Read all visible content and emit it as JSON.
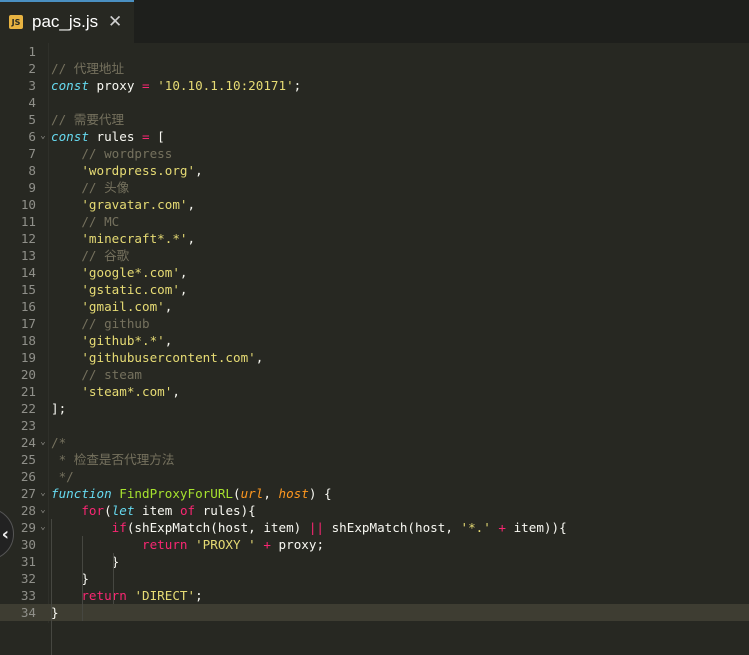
{
  "tab": {
    "title": "pac_js.js",
    "icon_label": "JS",
    "close_glyph": "✕"
  },
  "side_button": {
    "glyph": "‹"
  },
  "active_line": 34,
  "lines": [
    {
      "n": "1",
      "fold": "",
      "tokens": []
    },
    {
      "n": "2",
      "fold": "",
      "tokens": [
        {
          "t": "// 代理地址",
          "c": "c"
        }
      ]
    },
    {
      "n": "3",
      "fold": "",
      "tokens": [
        {
          "t": "const",
          "c": "k"
        },
        {
          "t": " proxy "
        },
        {
          "t": "=",
          "c": "r"
        },
        {
          "t": " "
        },
        {
          "t": "'10.10.1.10:20171'",
          "c": "s"
        },
        {
          "t": ";"
        }
      ]
    },
    {
      "n": "4",
      "fold": "",
      "tokens": []
    },
    {
      "n": "5",
      "fold": "",
      "tokens": [
        {
          "t": "// 需要代理",
          "c": "c"
        }
      ]
    },
    {
      "n": "6",
      "fold": "⌄",
      "tokens": [
        {
          "t": "const",
          "c": "k"
        },
        {
          "t": " rules "
        },
        {
          "t": "=",
          "c": "r"
        },
        {
          "t": " ["
        }
      ]
    },
    {
      "n": "7",
      "fold": "",
      "tokens": [
        {
          "t": "    "
        },
        {
          "t": "// wordpress",
          "c": "c"
        }
      ]
    },
    {
      "n": "8",
      "fold": "",
      "tokens": [
        {
          "t": "    "
        },
        {
          "t": "'wordpress.org'",
          "c": "s"
        },
        {
          "t": ","
        }
      ]
    },
    {
      "n": "9",
      "fold": "",
      "tokens": [
        {
          "t": "    "
        },
        {
          "t": "// 头像",
          "c": "c"
        }
      ]
    },
    {
      "n": "10",
      "fold": "",
      "tokens": [
        {
          "t": "    "
        },
        {
          "t": "'gravatar.com'",
          "c": "s"
        },
        {
          "t": ","
        }
      ]
    },
    {
      "n": "11",
      "fold": "",
      "tokens": [
        {
          "t": "    "
        },
        {
          "t": "// MC",
          "c": "c"
        }
      ]
    },
    {
      "n": "12",
      "fold": "",
      "tokens": [
        {
          "t": "    "
        },
        {
          "t": "'minecraft*.*'",
          "c": "s"
        },
        {
          "t": ","
        }
      ]
    },
    {
      "n": "13",
      "fold": "",
      "tokens": [
        {
          "t": "    "
        },
        {
          "t": "// 谷歌",
          "c": "c"
        }
      ]
    },
    {
      "n": "14",
      "fold": "",
      "tokens": [
        {
          "t": "    "
        },
        {
          "t": "'google*.com'",
          "c": "s"
        },
        {
          "t": ","
        }
      ]
    },
    {
      "n": "15",
      "fold": "",
      "tokens": [
        {
          "t": "    "
        },
        {
          "t": "'gstatic.com'",
          "c": "s"
        },
        {
          "t": ","
        }
      ]
    },
    {
      "n": "16",
      "fold": "",
      "tokens": [
        {
          "t": "    "
        },
        {
          "t": "'gmail.com'",
          "c": "s"
        },
        {
          "t": ","
        }
      ]
    },
    {
      "n": "17",
      "fold": "",
      "tokens": [
        {
          "t": "    "
        },
        {
          "t": "// github",
          "c": "c"
        }
      ]
    },
    {
      "n": "18",
      "fold": "",
      "tokens": [
        {
          "t": "    "
        },
        {
          "t": "'github*.*'",
          "c": "s"
        },
        {
          "t": ","
        }
      ]
    },
    {
      "n": "19",
      "fold": "",
      "tokens": [
        {
          "t": "    "
        },
        {
          "t": "'githubusercontent.com'",
          "c": "s"
        },
        {
          "t": ","
        }
      ]
    },
    {
      "n": "20",
      "fold": "",
      "tokens": [
        {
          "t": "    "
        },
        {
          "t": "// steam",
          "c": "c"
        }
      ]
    },
    {
      "n": "21",
      "fold": "",
      "tokens": [
        {
          "t": "    "
        },
        {
          "t": "'steam*.com'",
          "c": "s"
        },
        {
          "t": ","
        }
      ]
    },
    {
      "n": "22",
      "fold": "",
      "tokens": [
        {
          "t": "];"
        }
      ]
    },
    {
      "n": "23",
      "fold": "",
      "tokens": []
    },
    {
      "n": "24",
      "fold": "⌄",
      "tokens": [
        {
          "t": "/*",
          "c": "c"
        }
      ]
    },
    {
      "n": "25",
      "fold": "",
      "tokens": [
        {
          "t": " * 检查是否代理方法",
          "c": "c"
        }
      ]
    },
    {
      "n": "26",
      "fold": "",
      "tokens": [
        {
          "t": " */",
          "c": "c"
        }
      ]
    },
    {
      "n": "27",
      "fold": "⌄",
      "tokens": [
        {
          "t": "function",
          "c": "k"
        },
        {
          "t": " "
        },
        {
          "t": "FindProxyForURL",
          "c": "f"
        },
        {
          "t": "("
        },
        {
          "t": "url",
          "c": "p"
        },
        {
          "t": ", "
        },
        {
          "t": "host",
          "c": "p"
        },
        {
          "t": ") {"
        }
      ]
    },
    {
      "n": "28",
      "fold": "⌄",
      "tokens": [
        {
          "t": "    "
        },
        {
          "t": "for",
          "c": "r"
        },
        {
          "t": "("
        },
        {
          "t": "let",
          "c": "k"
        },
        {
          "t": " item "
        },
        {
          "t": "of",
          "c": "r"
        },
        {
          "t": " rules){"
        }
      ]
    },
    {
      "n": "29",
      "fold": "⌄",
      "tokens": [
        {
          "t": "        "
        },
        {
          "t": "if",
          "c": "r"
        },
        {
          "t": "(shExpMatch(host, item) "
        },
        {
          "t": "||",
          "c": "r"
        },
        {
          "t": " shExpMatch(host, "
        },
        {
          "t": "'*.'",
          "c": "s"
        },
        {
          "t": " "
        },
        {
          "t": "+",
          "c": "r"
        },
        {
          "t": " item)){"
        }
      ]
    },
    {
      "n": "30",
      "fold": "",
      "tokens": [
        {
          "t": "            "
        },
        {
          "t": "return",
          "c": "r"
        },
        {
          "t": " "
        },
        {
          "t": "'PROXY '",
          "c": "s"
        },
        {
          "t": " "
        },
        {
          "t": "+",
          "c": "r"
        },
        {
          "t": " proxy;"
        }
      ]
    },
    {
      "n": "31",
      "fold": "",
      "tokens": [
        {
          "t": "        }"
        }
      ]
    },
    {
      "n": "32",
      "fold": "",
      "tokens": [
        {
          "t": "    }"
        }
      ]
    },
    {
      "n": "33",
      "fold": "",
      "tokens": [
        {
          "t": "    "
        },
        {
          "t": "return",
          "c": "r"
        },
        {
          "t": " "
        },
        {
          "t": "'DIRECT'",
          "c": "s"
        },
        {
          "t": ";"
        }
      ]
    },
    {
      "n": "34",
      "fold": "",
      "tokens": [
        {
          "t": "}"
        }
      ]
    }
  ]
}
